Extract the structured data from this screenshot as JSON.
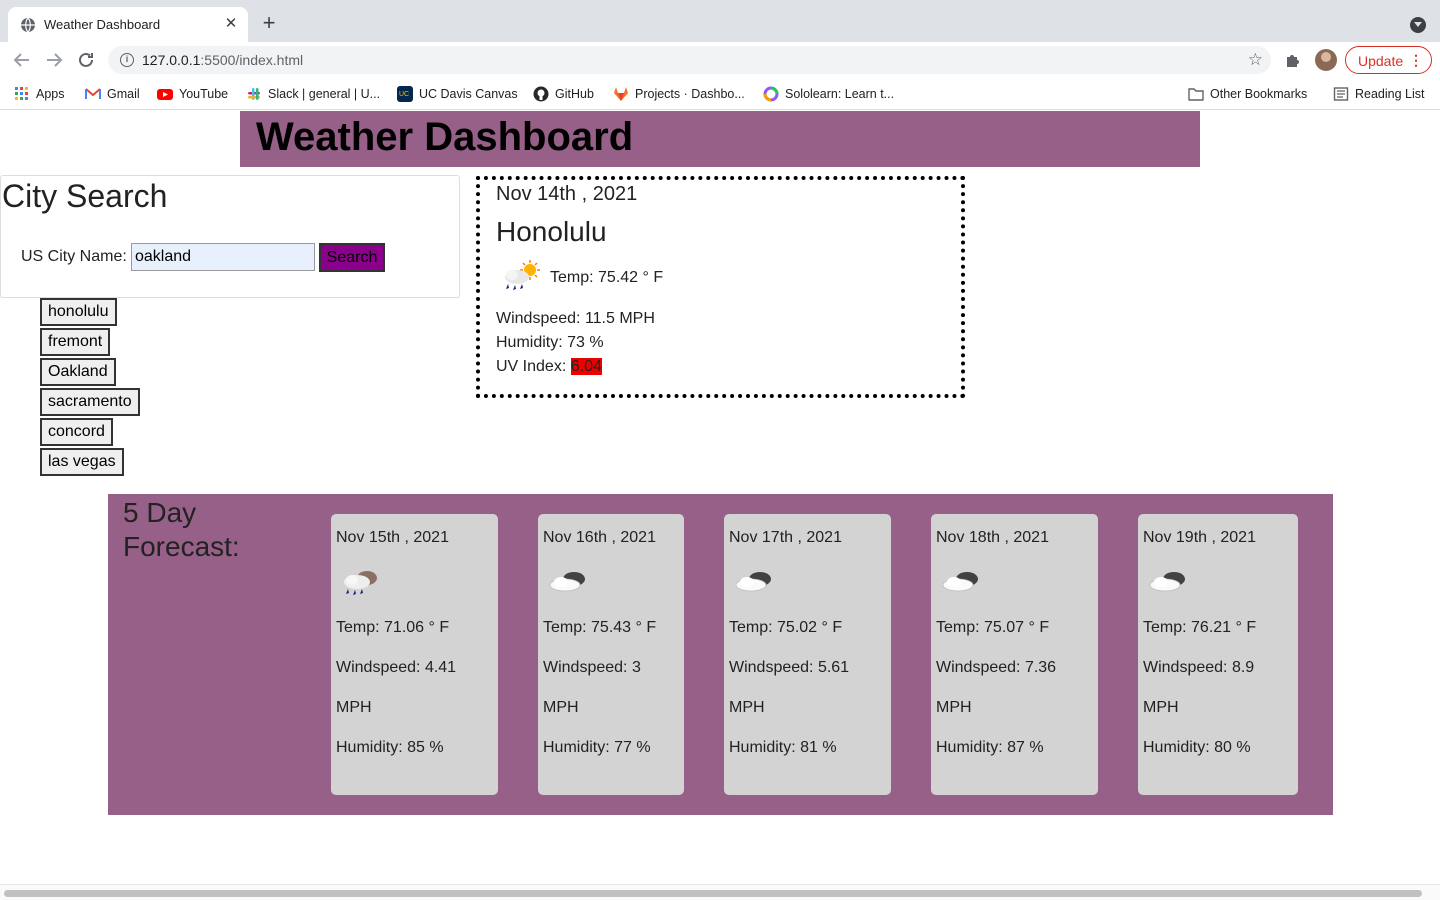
{
  "browser": {
    "tab_title": "Weather Dashboard",
    "tab_close": "✕",
    "new_tab": "+",
    "url_host": "127.0.0.1",
    "url_path": ":5500/index.html",
    "update_label": "Update",
    "update_menu": "⋮",
    "bookmarks": [
      {
        "label": "Apps",
        "color": "#4285f4"
      },
      {
        "label": "Gmail",
        "color": "#ea4335"
      },
      {
        "label": "YouTube",
        "color": "#ff0000"
      },
      {
        "label": "Slack | general | U...",
        "color": "#4a154b"
      },
      {
        "label": "UC Davis Canvas",
        "color": "#022851"
      },
      {
        "label": "GitHub",
        "color": "#24292e"
      },
      {
        "label": "Projects · Dashbo...",
        "color": "#fc6d26"
      },
      {
        "label": "Sololearn: Learn t...",
        "color": "#8b5cf6"
      }
    ],
    "other_bookmarks": "Other Bookmarks",
    "reading_list": "Reading List"
  },
  "header": {
    "title": "Weather Dashboard"
  },
  "search": {
    "title": "City Search",
    "label": "US City Name:",
    "input_value": "oakland",
    "button": "Search"
  },
  "history": [
    "honolulu",
    "fremont",
    "Oakland",
    "sacramento",
    "concord",
    "las vegas"
  ],
  "current": {
    "date": "Nov 14th , 2021",
    "city": "Honolulu",
    "icon": "rain-sun-icon",
    "temp": "Temp: 75.42 ° F",
    "wind": "Windspeed: 11.5 MPH",
    "humidity": "Humidity: 73 %",
    "uv_label": "UV Index:",
    "uv_value": "6.04",
    "uv_color": "#ee0000"
  },
  "forecast": {
    "title": "5 Day Forecast:",
    "days": [
      {
        "date": "Nov 15th , 2021",
        "icon": "rain-cloud-icon",
        "temp": "Temp: 71.06 ° F",
        "wind": "Windspeed: 4.41",
        "wind_unit": "MPH",
        "humidity": "Humidity: 85 %"
      },
      {
        "date": "Nov 16th , 2021",
        "icon": "cloud-icon",
        "temp": "Temp: 75.43 ° F",
        "wind": "Windspeed: 3",
        "wind_unit": "MPH",
        "humidity": "Humidity: 77 %"
      },
      {
        "date": "Nov 17th , 2021",
        "icon": "cloud-icon",
        "temp": "Temp: 75.02 ° F",
        "wind": "Windspeed: 5.61",
        "wind_unit": "MPH",
        "humidity": "Humidity: 81 %"
      },
      {
        "date": "Nov 18th , 2021",
        "icon": "cloud-icon",
        "temp": "Temp: 75.07 ° F",
        "wind": "Windspeed: 7.36",
        "wind_unit": "MPH",
        "humidity": "Humidity: 87 %"
      },
      {
        "date": "Nov 19th , 2021",
        "icon": "cloud-icon",
        "temp": "Temp: 76.21 ° F",
        "wind": "Windspeed: 8.9",
        "wind_unit": "MPH",
        "humidity": "Humidity: 80 %"
      }
    ]
  },
  "colors": {
    "header_bg": "#976088",
    "search_btn": "#8b008b",
    "card_bg": "#d3d3d3"
  }
}
